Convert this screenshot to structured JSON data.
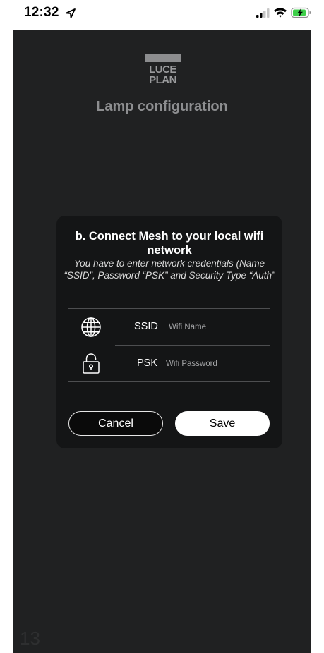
{
  "status_bar": {
    "time": "12:32",
    "location_icon": "location-arrow-icon",
    "signal_icon": "cellular-signal-icon",
    "wifi_icon": "wifi-icon",
    "battery_icon": "battery-charging-icon"
  },
  "logo": {
    "line1": "LUCE",
    "line2": "PLAN"
  },
  "header": {
    "title": "Lamp configuration"
  },
  "dialog": {
    "title": "b. Connect Mesh to your local wifi network",
    "description": "You have to enter network credentials (Name “SSID”, Password “PSK” and Security Type “Auth”",
    "fields": [
      {
        "icon": "globe-icon",
        "label": "SSID",
        "placeholder": "Wifi Name",
        "value": ""
      },
      {
        "icon": "lock-icon",
        "label": "PSK",
        "placeholder": "Wifi Password",
        "value": ""
      }
    ],
    "cancel_label": "Cancel",
    "save_label": "Save"
  },
  "page_number": "13",
  "colors": {
    "screen_bg": "#202122",
    "dialog_bg": "#141516",
    "title_text": "#8d8e90",
    "accent": "#ffffff"
  }
}
